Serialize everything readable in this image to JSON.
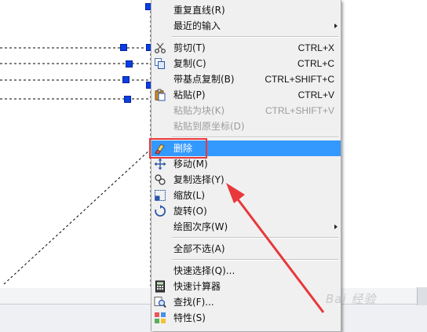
{
  "menu": {
    "items": [
      {
        "label": "重复直线(R)",
        "icon": "none",
        "submenu": false,
        "state": "normal"
      },
      {
        "label": "最近的输入",
        "icon": "none",
        "submenu": true,
        "state": "normal"
      },
      {
        "separator": true
      },
      {
        "label": "剪切(T)",
        "shortcut": "CTRL+X",
        "icon": "scissors-icon",
        "state": "normal"
      },
      {
        "label": "复制(C)",
        "shortcut": "CTRL+C",
        "icon": "copy-icon",
        "state": "normal"
      },
      {
        "label": "带基点复制(B)",
        "shortcut": "CTRL+SHIFT+C",
        "icon": "none",
        "state": "normal"
      },
      {
        "label": "粘贴(P)",
        "shortcut": "CTRL+V",
        "icon": "paste-icon",
        "state": "normal"
      },
      {
        "label": "粘贴为块(K)",
        "shortcut": "CTRL+SHIFT+V",
        "icon": "none",
        "state": "disabled"
      },
      {
        "label": "粘贴到原坐标(D)",
        "icon": "none",
        "state": "disabled"
      },
      {
        "separator": true
      },
      {
        "label": "删除",
        "icon": "eraser-icon",
        "state": "highlight"
      },
      {
        "label": "移动(M)",
        "icon": "move-icon",
        "state": "normal"
      },
      {
        "label": "复制选择(Y)",
        "icon": "copy-selection-icon",
        "state": "normal"
      },
      {
        "label": "缩放(L)",
        "icon": "scale-icon",
        "state": "normal"
      },
      {
        "label": "旋转(O)",
        "icon": "rotate-icon",
        "state": "normal"
      },
      {
        "label": "绘图次序(W)",
        "icon": "none",
        "submenu": true,
        "state": "normal"
      },
      {
        "separator": true
      },
      {
        "label": "全部不选(A)",
        "icon": "none",
        "state": "normal"
      },
      {
        "separator": true
      },
      {
        "label": "快速选择(Q)...",
        "icon": "none",
        "state": "normal"
      },
      {
        "label": "快速计算器",
        "icon": "calculator-icon",
        "state": "normal"
      },
      {
        "label": "查找(F)...",
        "icon": "find-icon",
        "state": "normal"
      },
      {
        "label": "特性(S)",
        "icon": "properties-icon",
        "state": "normal"
      }
    ]
  },
  "watermark": "Bai 经验",
  "colors": {
    "highlight": "#3399ff",
    "grip": "#0a3fe0",
    "annotation": "#e8383b"
  }
}
